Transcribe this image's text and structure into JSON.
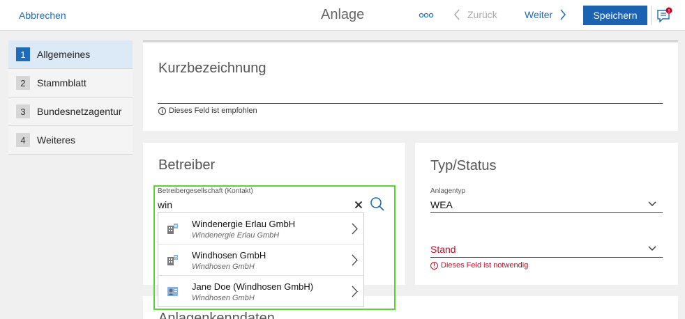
{
  "header": {
    "cancel_label": "Abbrechen",
    "title": "Anlage",
    "more_icon": "more-dots-icon",
    "back_label": "Zurück",
    "next_label": "Weiter",
    "save_label": "Speichern",
    "feedback_icon": "feedback-chat-icon"
  },
  "sidebar": {
    "items": [
      {
        "num": "1",
        "label": "Allgemeines",
        "active": true
      },
      {
        "num": "2",
        "label": "Stammblatt"
      },
      {
        "num": "3",
        "label": "Bundesnetzagentur"
      },
      {
        "num": "4",
        "label": "Weiteres"
      }
    ]
  },
  "kurz": {
    "heading": "Kurzbezeichnung",
    "hint": "Dieses Feld ist empfohlen"
  },
  "betreiber": {
    "heading": "Betreiber",
    "field_label": "Betreibergesellschaft (Kontakt)",
    "value": "win",
    "suggestions": [
      {
        "name": "Windenergie Erlau GmbH",
        "sub": "Windenergie Erlau GmbH",
        "icon": "company-icon"
      },
      {
        "name": "Windhosen GmbH",
        "sub": "Windhosen GmbH",
        "icon": "company-icon"
      },
      {
        "name": "Jane Doe (Windhosen GmbH)",
        "sub": "Windhosen GmbH",
        "icon": "contact-person-icon"
      }
    ]
  },
  "typstatus": {
    "heading": "Typ/Status",
    "anlagentyp_label": "Anlagentyp",
    "anlagentyp_value": "WEA",
    "stand_label": "Stand",
    "stand_error": "Dieses Feld ist notwendig"
  },
  "anlagen": {
    "heading": "Anlagenkenndaten"
  },
  "colors": {
    "accent": "#1e6bb8",
    "error": "#b3142a",
    "focus": "#5ad42e"
  }
}
